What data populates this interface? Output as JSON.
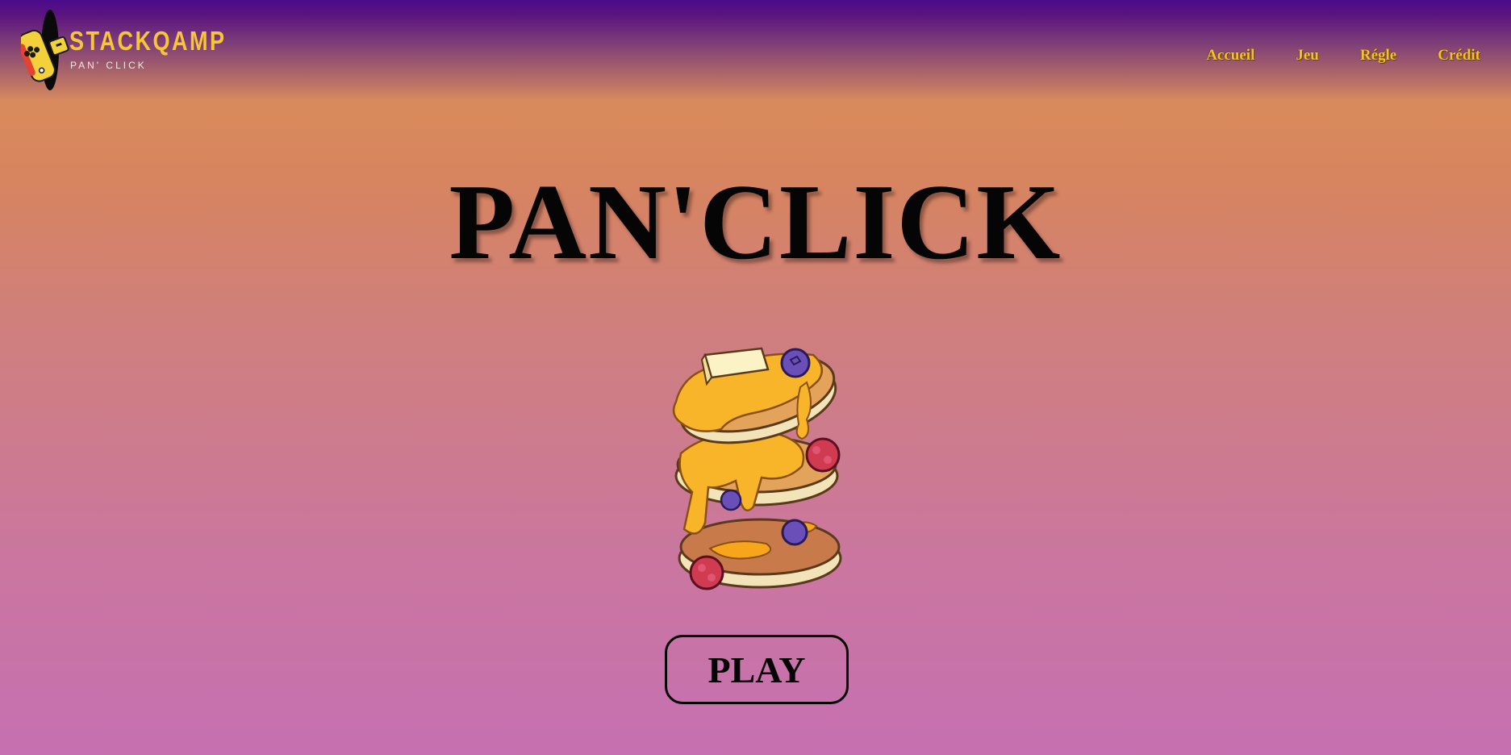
{
  "header": {
    "logo": {
      "title": "STACKQAMP",
      "subtitle": "PAN' CLICK",
      "icon": "gamepad-icon"
    },
    "nav": [
      {
        "label": "Accueil"
      },
      {
        "label": "Jeu"
      },
      {
        "label": "Régle"
      },
      {
        "label": "Crédit"
      }
    ]
  },
  "main": {
    "title": "PAN'CLICK",
    "illustration": "pancake-stack-illustration",
    "play_label": "PLAY"
  },
  "colors": {
    "accent_yellow": "#f3c12a",
    "header_purple": "#4a0a8c",
    "background_top": "#d88a5d",
    "background_bottom": "#c670b1",
    "text_dark": "#050505"
  }
}
